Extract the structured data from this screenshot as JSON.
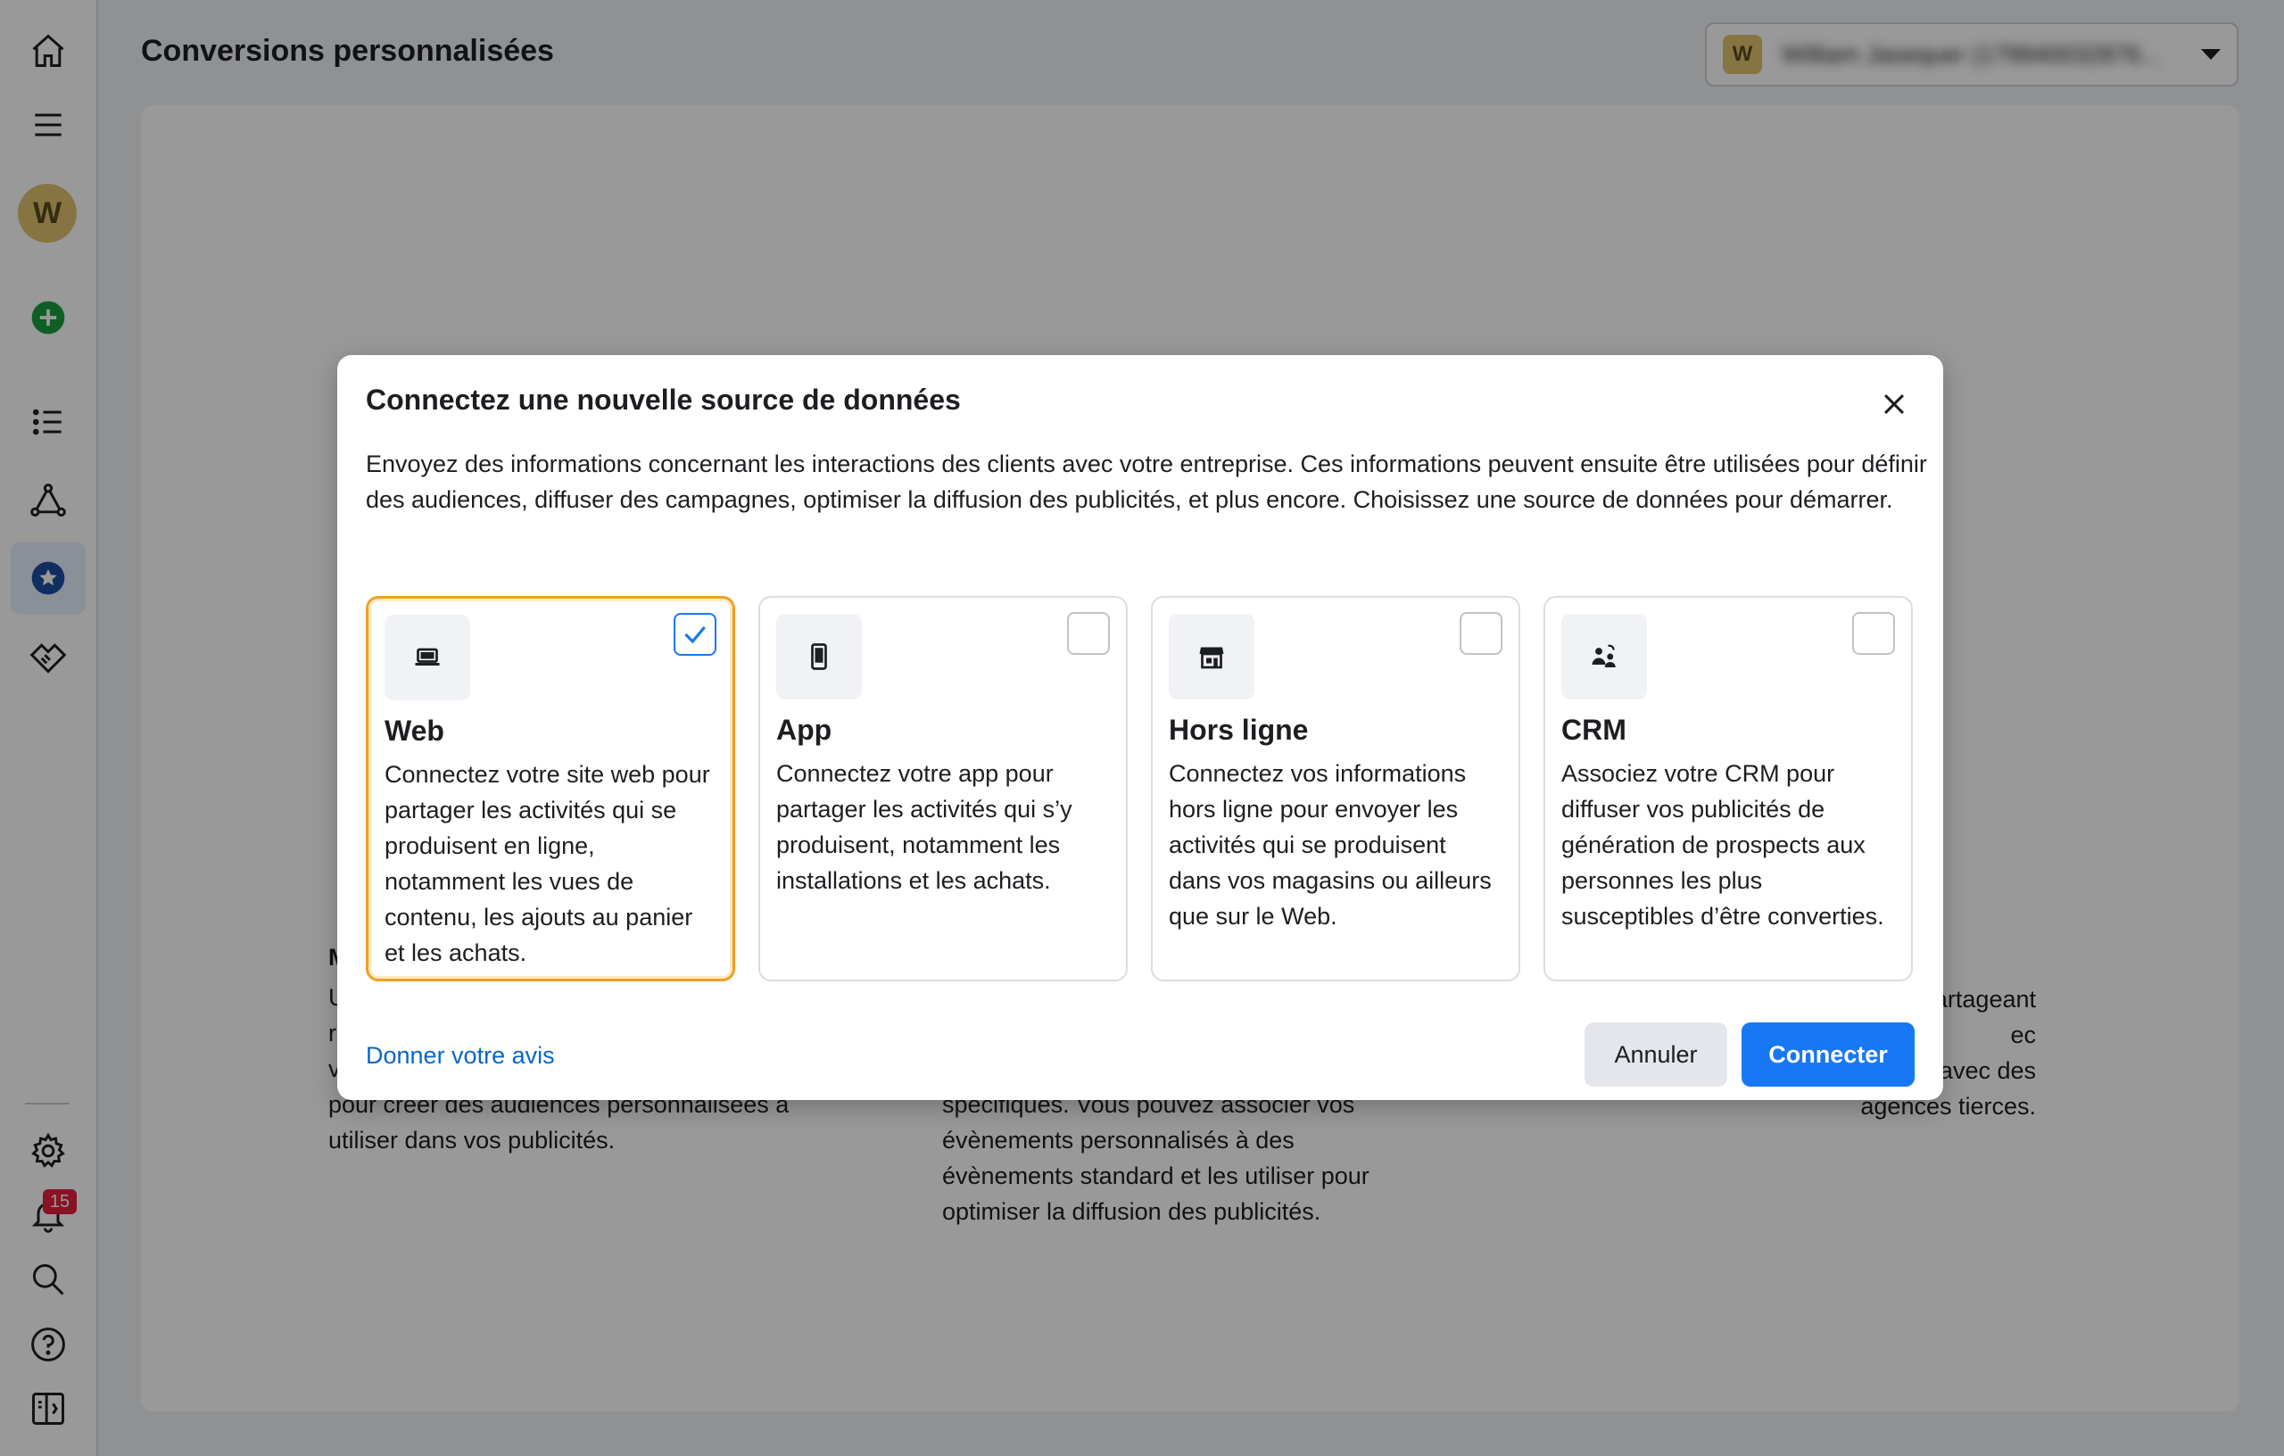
{
  "header": {
    "title": "Conversions personnalisées",
    "account_initial": "W",
    "account_name": "William Jasequer (179940032876..."
  },
  "rail": {
    "avatar_initial": "W",
    "notifications_count": "15"
  },
  "background": {
    "col1_head": "M",
    "col1_text": "U\nr\nv\npour créer des audiences personnalisées à\nutiliser dans vos publicités.",
    "col2_text": "spécifiques. Vous pouvez associer vos\névènements personnalisés à des\névènements standard et les utiliser pour\noptimiser la diffusion des publicités.",
    "col3_text": "artageant\nec\nprofessionnels sur Facebook, ou avec des\nagences tierces."
  },
  "modal": {
    "title": "Connectez une nouvelle source de données",
    "description": "Envoyez des informations concernant les interactions des clients avec votre entreprise. Ces informations peuvent ensuite être utilisées pour définir des audiences, diffuser des campagnes, optimiser la diffusion des publicités, et plus encore. Choisissez une source de données pour démarrer.",
    "cards": [
      {
        "title": "Web",
        "description": "Connectez votre site web pour partager les activités qui se produisent en ligne, notamment les vues de contenu, les ajouts au panier et les achats.",
        "icon": "laptop-icon",
        "selected": true
      },
      {
        "title": "App",
        "description": "Connectez votre app pour partager les activités qui s’y produisent, notamment les installations et les achats.",
        "icon": "phone-icon",
        "selected": false
      },
      {
        "title": "Hors ligne",
        "description": "Connectez vos informations hors ligne pour envoyer les activités qui se produisent dans vos magasins ou ailleurs que sur le Web.",
        "icon": "store-icon",
        "selected": false
      },
      {
        "title": "CRM",
        "description": "Associez votre CRM pour diffuser vos publicités de génération de prospects aux personnes les plus susceptibles d’être converties.",
        "icon": "people-icon",
        "selected": false
      }
    ],
    "feedback_link": "Donner votre avis",
    "cancel_label": "Annuler",
    "connect_label": "Connecter"
  },
  "colors": {
    "primary": "#1877f2",
    "selected_border": "#f0a020",
    "link": "#0a66c2"
  }
}
